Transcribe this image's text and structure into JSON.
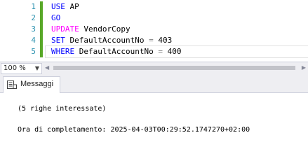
{
  "editor": {
    "lines": [
      {
        "num": "1",
        "tokens": [
          {
            "text": "USE",
            "cls": "kw"
          },
          {
            "text": " AP",
            "cls": ""
          }
        ]
      },
      {
        "num": "2",
        "tokens": [
          {
            "text": "GO",
            "cls": "kw"
          }
        ]
      },
      {
        "num": "3",
        "tokens": [
          {
            "text": "UPDATE",
            "cls": "kw-pink"
          },
          {
            "text": " VendorCopy",
            "cls": ""
          }
        ]
      },
      {
        "num": "4",
        "tokens": [
          {
            "text": "SET",
            "cls": "kw"
          },
          {
            "text": " DefaultAccountNo ",
            "cls": ""
          },
          {
            "text": "=",
            "cls": "kw-gray"
          },
          {
            "text": " 403",
            "cls": ""
          }
        ]
      },
      {
        "num": "5",
        "tokens": [
          {
            "text": "WHERE",
            "cls": "kw"
          },
          {
            "text": " DefaultAccountNo ",
            "cls": ""
          },
          {
            "text": "=",
            "cls": "kw-gray"
          },
          {
            "text": " 400",
            "cls": ""
          }
        ]
      }
    ],
    "change_bar_color": "#58a828",
    "line_number_color": "#2b91af"
  },
  "zoom": {
    "value": "100 %",
    "arrow_icon": "chevron-down-icon"
  },
  "results": {
    "tab_label": "Messaggi",
    "tab_icon": "messages-icon",
    "messages": [
      "(5 righe interessate)",
      "Ora di completamento: 2025-04-03T00:29:52.1747270+02:00"
    ]
  }
}
